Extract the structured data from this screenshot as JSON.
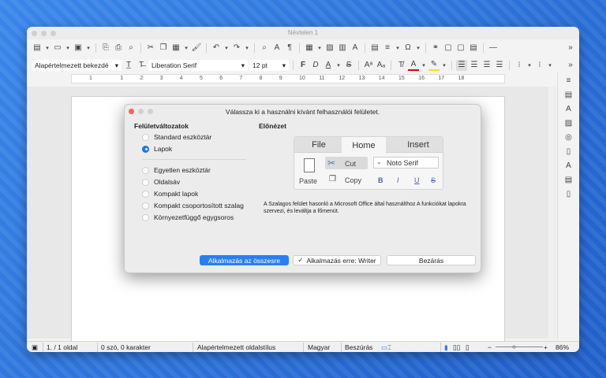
{
  "window": {
    "title": "Névtelen 1"
  },
  "formatting": {
    "paragraph_style": "Alapértelmezett bekezdé",
    "font_name": "Liberation Serif",
    "font_size": "12 pt"
  },
  "ruler": {
    "numbers": [
      "1",
      "1",
      "2",
      "3",
      "4",
      "5",
      "6",
      "7",
      "8",
      "9",
      "10",
      "11",
      "12",
      "13",
      "14",
      "15",
      "16",
      "17",
      "18"
    ]
  },
  "status": {
    "page": "1. / 1 oldal",
    "words": "0 szó, 0 karakter",
    "page_style": "Alapértelmezett oldalstílus",
    "language": "Magyar",
    "insert_mode": "Beszúrás",
    "zoom": "86%"
  },
  "dialog": {
    "title": "Válassza ki a használni kívánt felhasználói felületet.",
    "variants_heading": "Felületváltozatok",
    "preview_heading": "Előnézet",
    "options": [
      "Standard eszköztár",
      "Lapok",
      "Egyetlen eszköztár",
      "Oldalsáv",
      "Kompakt lapok",
      "Kompakt csoportosított szalag",
      "Környezetfüggő egygsoros"
    ],
    "selected_option": "Lapok",
    "preview": {
      "tabs": [
        "File",
        "Home",
        "Insert"
      ],
      "active_tab": "Home",
      "paste": "Paste",
      "cut": "Cut",
      "copy": "Copy",
      "font": "Noto Serif",
      "bold": "B",
      "italic": "I",
      "underline": "U",
      "strike": "S"
    },
    "description": "A Szalagos felület hasonló a Microsoft Office által használthoz A funkciókat lapokra szervezi, és leváltja a főmenüt.",
    "apply_all": "Alkalmazás az összesre",
    "apply_writer": "Alkalmazás erre: Writer",
    "close": "Bezárás",
    "apply_writer_checked": true
  },
  "colors": {
    "accent": "#2a7ef0",
    "desktop": "#2f7be0"
  }
}
